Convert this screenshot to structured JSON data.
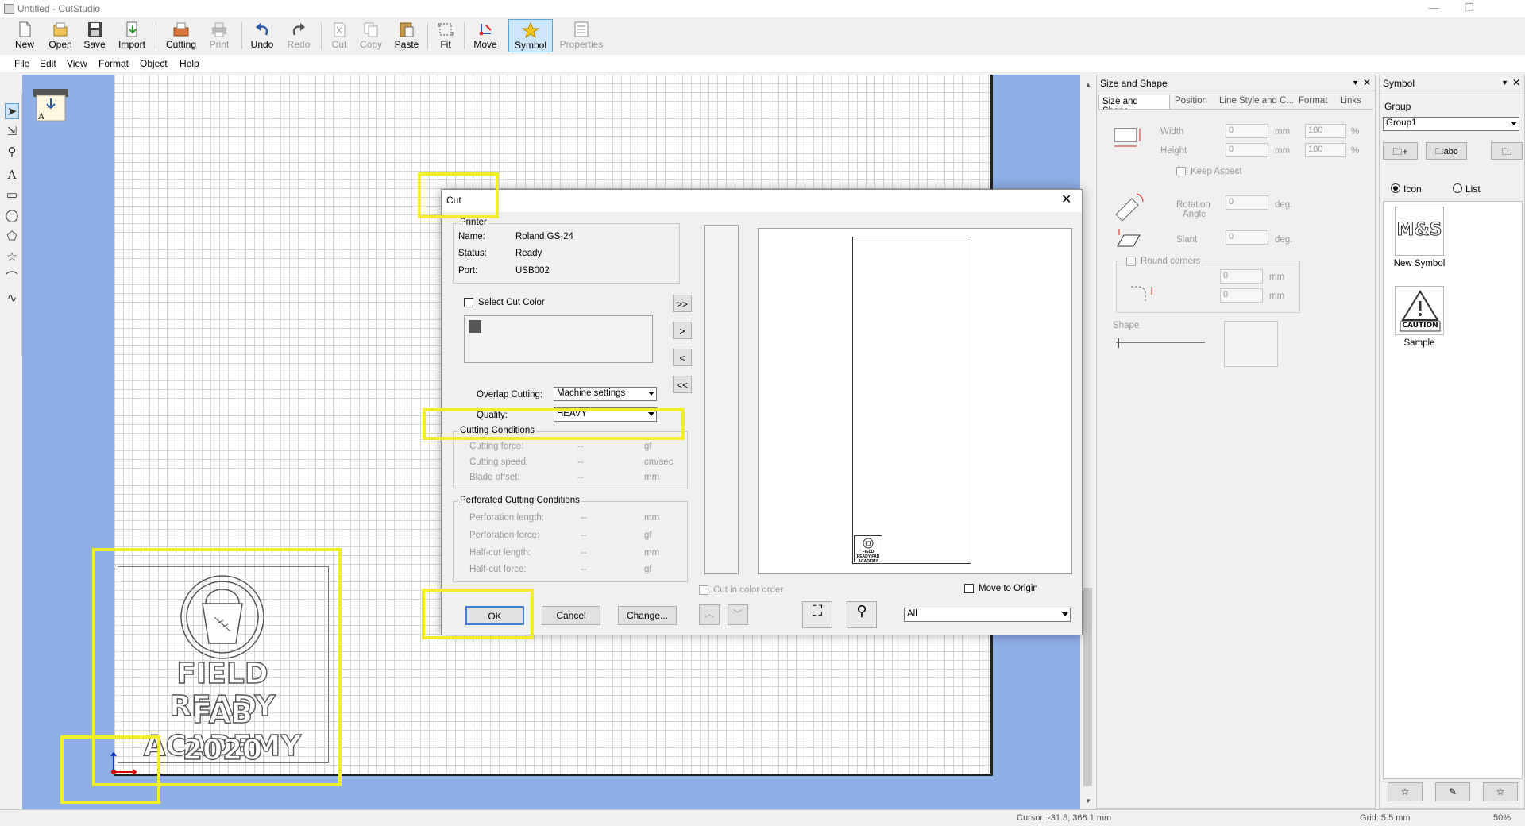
{
  "window": {
    "title": "Untitled - CutStudio",
    "min": "—",
    "restore": "❐"
  },
  "toolbar": {
    "new": "New",
    "open": "Open",
    "save": "Save",
    "import": "Import",
    "cutting": "Cutting",
    "print": "Print",
    "undo": "Undo",
    "redo": "Redo",
    "cut": "Cut",
    "copy": "Copy",
    "paste": "Paste",
    "fit": "Fit",
    "move": "Move",
    "symbol": "Symbol",
    "properties": "Properties"
  },
  "menu": [
    "File",
    "Edit",
    "View",
    "Format",
    "Object",
    "Help"
  ],
  "design": {
    "line1": "FIELD READY",
    "line2": "FAB ACADEMY",
    "line3": "2020"
  },
  "cut_dialog": {
    "title": "Cut",
    "printer_group": "Printer",
    "name_label": "Name:",
    "name_value": "Roland GS-24",
    "status_label": "Status:",
    "status_value": "Ready",
    "port_label": "Port:",
    "port_value": "USB002",
    "select_cut_color": "Select Cut Color",
    "move_buttons": [
      ">>",
      ">",
      "<",
      "<<"
    ],
    "overlap_label": "Overlap Cutting:",
    "overlap_value": "Machine settings",
    "quality_label": "Quality:",
    "quality_value": "HEAVY",
    "cc_group": "Cutting Conditions",
    "cc_rows": [
      {
        "label": "Cutting force:",
        "value": "--",
        "unit": "gf"
      },
      {
        "label": "Cutting speed:",
        "value": "--",
        "unit": "cm/sec"
      },
      {
        "label": "Blade offset:",
        "value": "--",
        "unit": "mm"
      }
    ],
    "pcc_group": "Perforated Cutting Conditions",
    "pcc_rows": [
      {
        "label": "Perforation length:",
        "value": "--",
        "unit": "mm"
      },
      {
        "label": "Perforation  force:",
        "value": "--",
        "unit": "gf"
      },
      {
        "label": "Half-cut length:",
        "value": "--",
        "unit": "mm"
      },
      {
        "label": "Half-cut force:",
        "value": "--",
        "unit": "gf"
      }
    ],
    "cut_in_color_order": "Cut in color order",
    "move_to_origin": "Move to Origin",
    "ok": "OK",
    "cancel": "Cancel",
    "change": "Change...",
    "filter_value": "All",
    "preview_logo_text": "FIELD READY FAB ACADEMY"
  },
  "size_shape_panel": {
    "title": "Size and Shape",
    "tabs": [
      "Size and Shape",
      "Position",
      "Line Style and C...",
      "Format",
      "Links"
    ],
    "width_label": "Width",
    "width_value": "0",
    "width_unit": "mm",
    "width_pct": "100",
    "pct": "%",
    "height_label": "Height",
    "height_value": "0",
    "height_unit": "mm",
    "height_pct": "100",
    "keep_aspect": "Keep Aspect",
    "rotation_label1": "Rotation",
    "rotation_label2": "Angle",
    "rotation_value": "0",
    "deg": "deg.",
    "slant_label": "Slant",
    "slant_value": "0",
    "round_corners": "Round corners",
    "rc_value1": "0",
    "rc_value2": "0",
    "mm": "mm",
    "shape_label": "Shape"
  },
  "symbol_panel": {
    "title": "Symbol",
    "group_label": "Group",
    "group_value": "Group1",
    "abc": "abc",
    "icon_option": "Icon",
    "list_option": "List",
    "items": [
      {
        "glyph": "M&S",
        "label": "New Symbol"
      },
      {
        "glyph": "CAUTION",
        "label": "Sample"
      }
    ]
  },
  "status": {
    "cursor": "Cursor: -31.8, 368.1 mm",
    "grid": "Grid: 5.5 mm",
    "zoom": "50%"
  },
  "colors": {
    "highlight": "#f2ee2c",
    "workspace": "#8eaee6",
    "accent": "#5aa3dc"
  }
}
